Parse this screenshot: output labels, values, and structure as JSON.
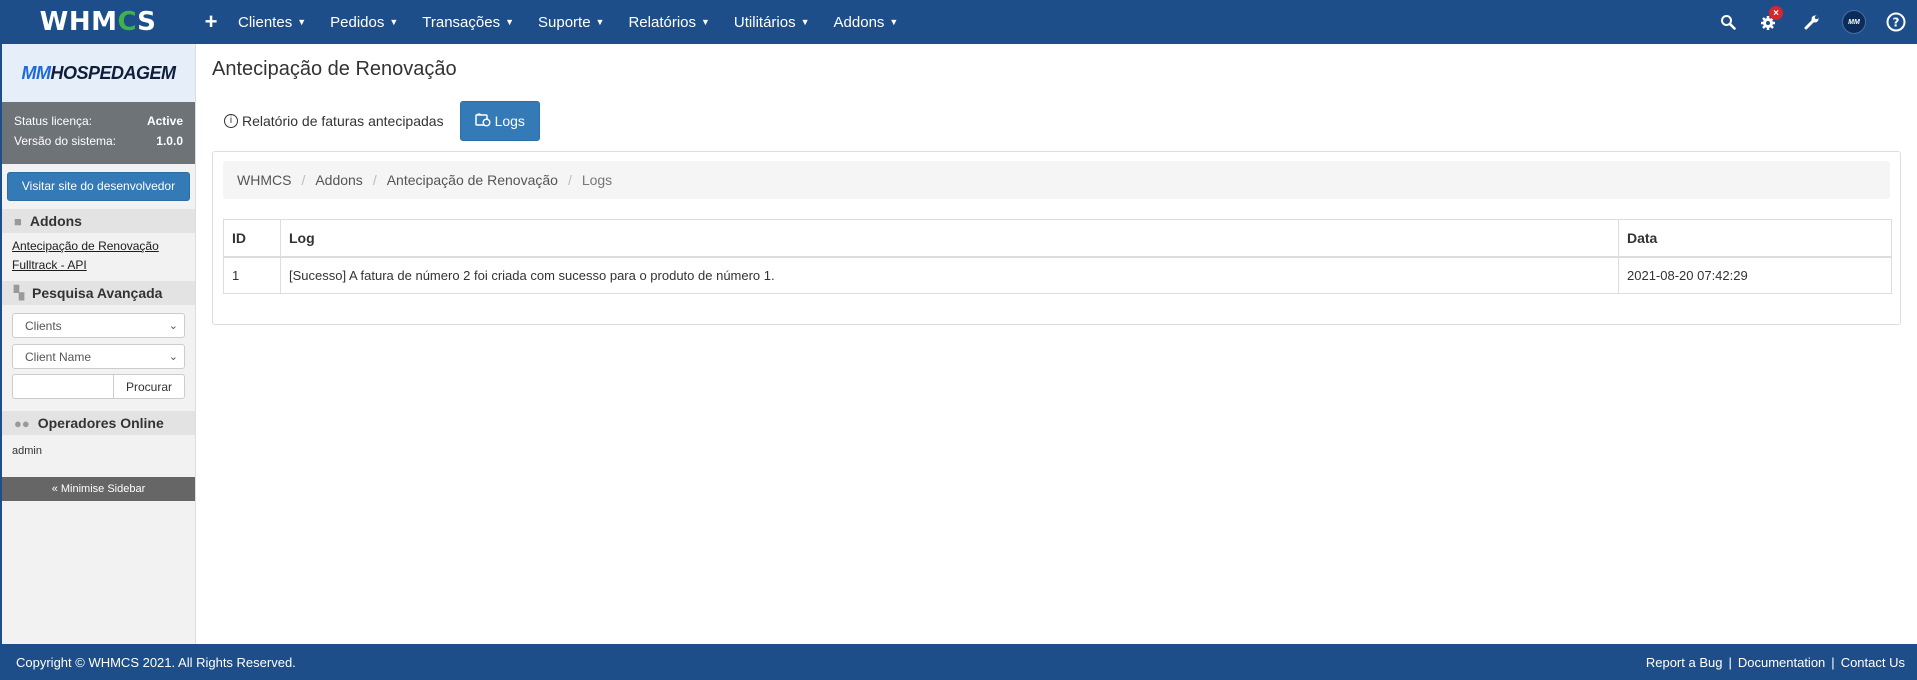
{
  "app": {
    "logo_prefix": "WHM",
    "logo_gear": "C",
    "logo_suffix": "S"
  },
  "nav": {
    "plus_label": "+",
    "items": [
      {
        "label": "Clientes"
      },
      {
        "label": "Pedidos"
      },
      {
        "label": "Transações"
      },
      {
        "label": "Suporte"
      },
      {
        "label": "Relatórios"
      },
      {
        "label": "Utilitários"
      },
      {
        "label": "Addons"
      }
    ],
    "right_icons": [
      "search-icon",
      "settings-cogs-icon",
      "wrench-icon",
      "user-avatar",
      "help-icon"
    ],
    "notification_badge": "×",
    "avatar_text": "MM"
  },
  "sidebar": {
    "brand_prefix": "MM",
    "brand_suffix": "HOSPEDAGEM",
    "status_label": "Status licença:",
    "status_value": "Active",
    "version_label": "Versão do sistema:",
    "version_value": "1.0.0",
    "dev_button": "Visitar site do desenvolvedor",
    "addons_title": "Addons",
    "addons_links": [
      {
        "label": "Antecipação de Renovação"
      },
      {
        "label": "Fulltrack - API"
      }
    ],
    "search_title": "Pesquisa Avançada",
    "search_type_value": "Clients",
    "search_field_value": "Client Name",
    "search_input_value": "",
    "search_button": "Procurar",
    "online_title": "Operadores Online",
    "online_user": "admin",
    "minimise": "« Minimise Sidebar"
  },
  "main": {
    "title": "Antecipação de Renovação",
    "tabs": {
      "report_label": "Relatório de faturas antecipadas",
      "logs_label": "Logs"
    },
    "breadcrumb": [
      "WHMCS",
      "Addons",
      "Antecipação de Renovação",
      "Logs"
    ],
    "table": {
      "headers": [
        "ID",
        "Log",
        "Data"
      ],
      "rows": [
        [
          "1",
          "[Sucesso] A fatura de número 2 foi criada com sucesso para o produto de número 1.",
          "2021-08-20 07:42:29"
        ]
      ]
    }
  },
  "footer": {
    "copyright": "Copyright © WHMCS 2021. All Rights Reserved.",
    "links": [
      "Report a Bug",
      "Documentation",
      "Contact Us"
    ],
    "separator": "|"
  },
  "colors": {
    "navbar": "#1d4e89",
    "primary_button": "#337ab7",
    "gear_green": "#3fb24a",
    "badge_red": "#d9262c"
  }
}
